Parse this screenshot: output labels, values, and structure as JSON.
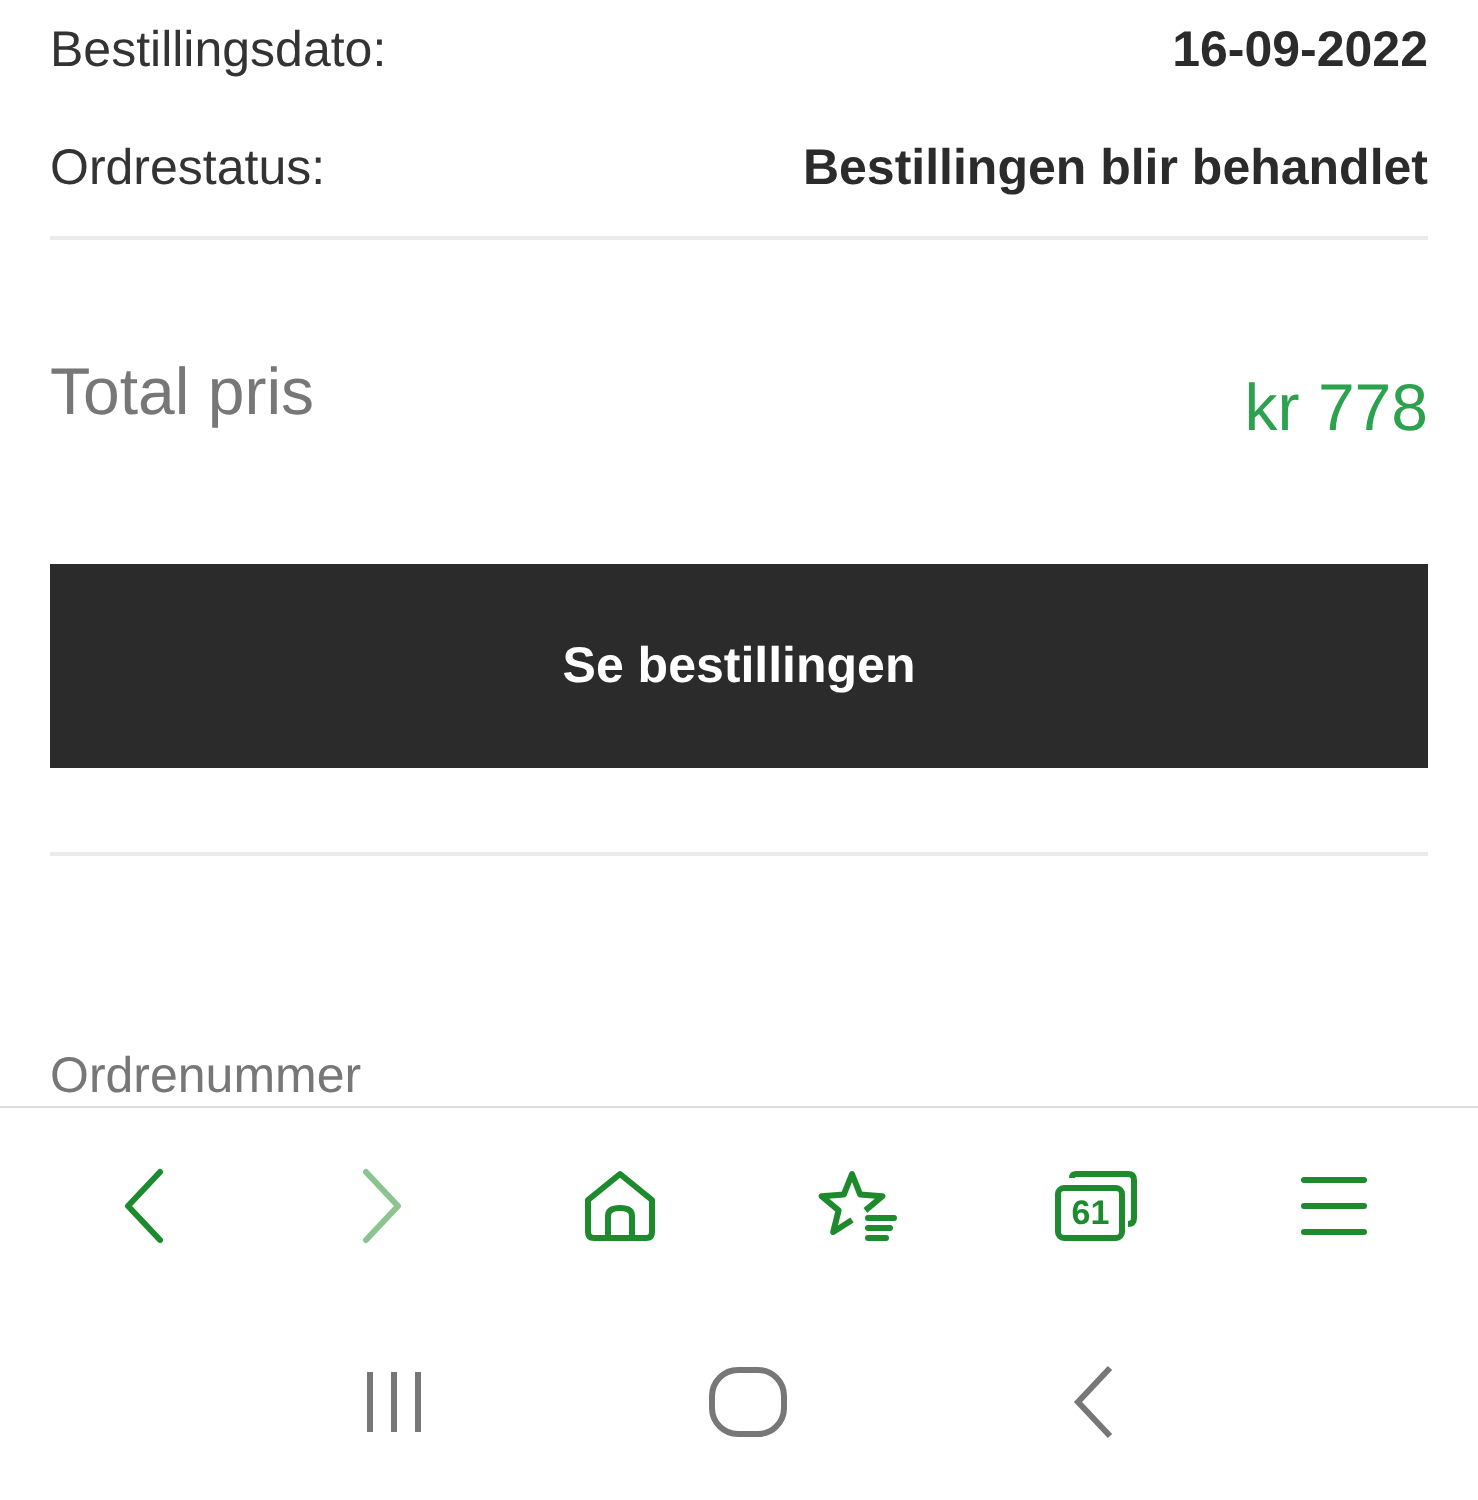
{
  "details": [
    {
      "label": "Bestillingsdato:",
      "value": "16-09-2022"
    },
    {
      "label": "Ordrestatus:",
      "value": "Bestillingen blir behandlet"
    }
  ],
  "total": {
    "label": "Total pris",
    "value": "kr 778"
  },
  "view_order_button": "Se bestillingen",
  "next_section_heading": "Ordrenummer",
  "browser_toolbar": [
    {
      "kind": "back",
      "disabled": false
    },
    {
      "kind": "forward",
      "disabled": true
    },
    {
      "kind": "home",
      "disabled": false
    },
    {
      "kind": "bookmarks",
      "disabled": false
    },
    {
      "kind": "tabs",
      "count": "61",
      "disabled": false
    },
    {
      "kind": "menu",
      "disabled": false
    }
  ],
  "system_nav": [
    {
      "kind": "recents"
    },
    {
      "kind": "home"
    },
    {
      "kind": "back"
    }
  ]
}
